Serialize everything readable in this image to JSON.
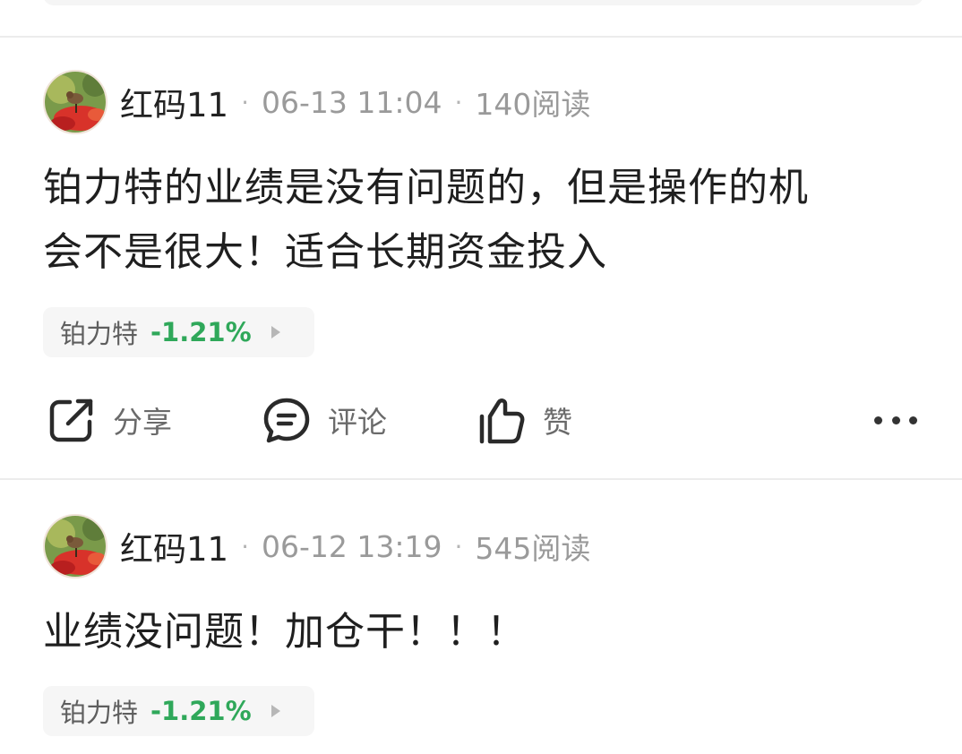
{
  "posts": [
    {
      "username": "红码11",
      "date": "06-13 11:04",
      "reads": "140阅读",
      "content_lines": [
        "铂力特的业绩是没有问题的，但是操作的机",
        "会不是很大！适合长期资金投入"
      ],
      "stock": {
        "name": "铂力特",
        "change": "-1.21%"
      },
      "actions": {
        "share": "分享",
        "comment": "评论",
        "like": "赞"
      }
    },
    {
      "username": "红码11",
      "date": "06-12 13:19",
      "reads": "545阅读",
      "content_lines": [
        "业绩没问题！加仓干！！！"
      ],
      "stock": {
        "name": "铂力特",
        "change": "-1.21%"
      }
    }
  ],
  "separator": "·",
  "colors": {
    "negative_change": "#2fa85a",
    "muted_text": "#9a9a9a"
  },
  "icons": [
    "share-icon",
    "comment-icon",
    "like-icon",
    "more-icon",
    "chevron-right-icon"
  ]
}
